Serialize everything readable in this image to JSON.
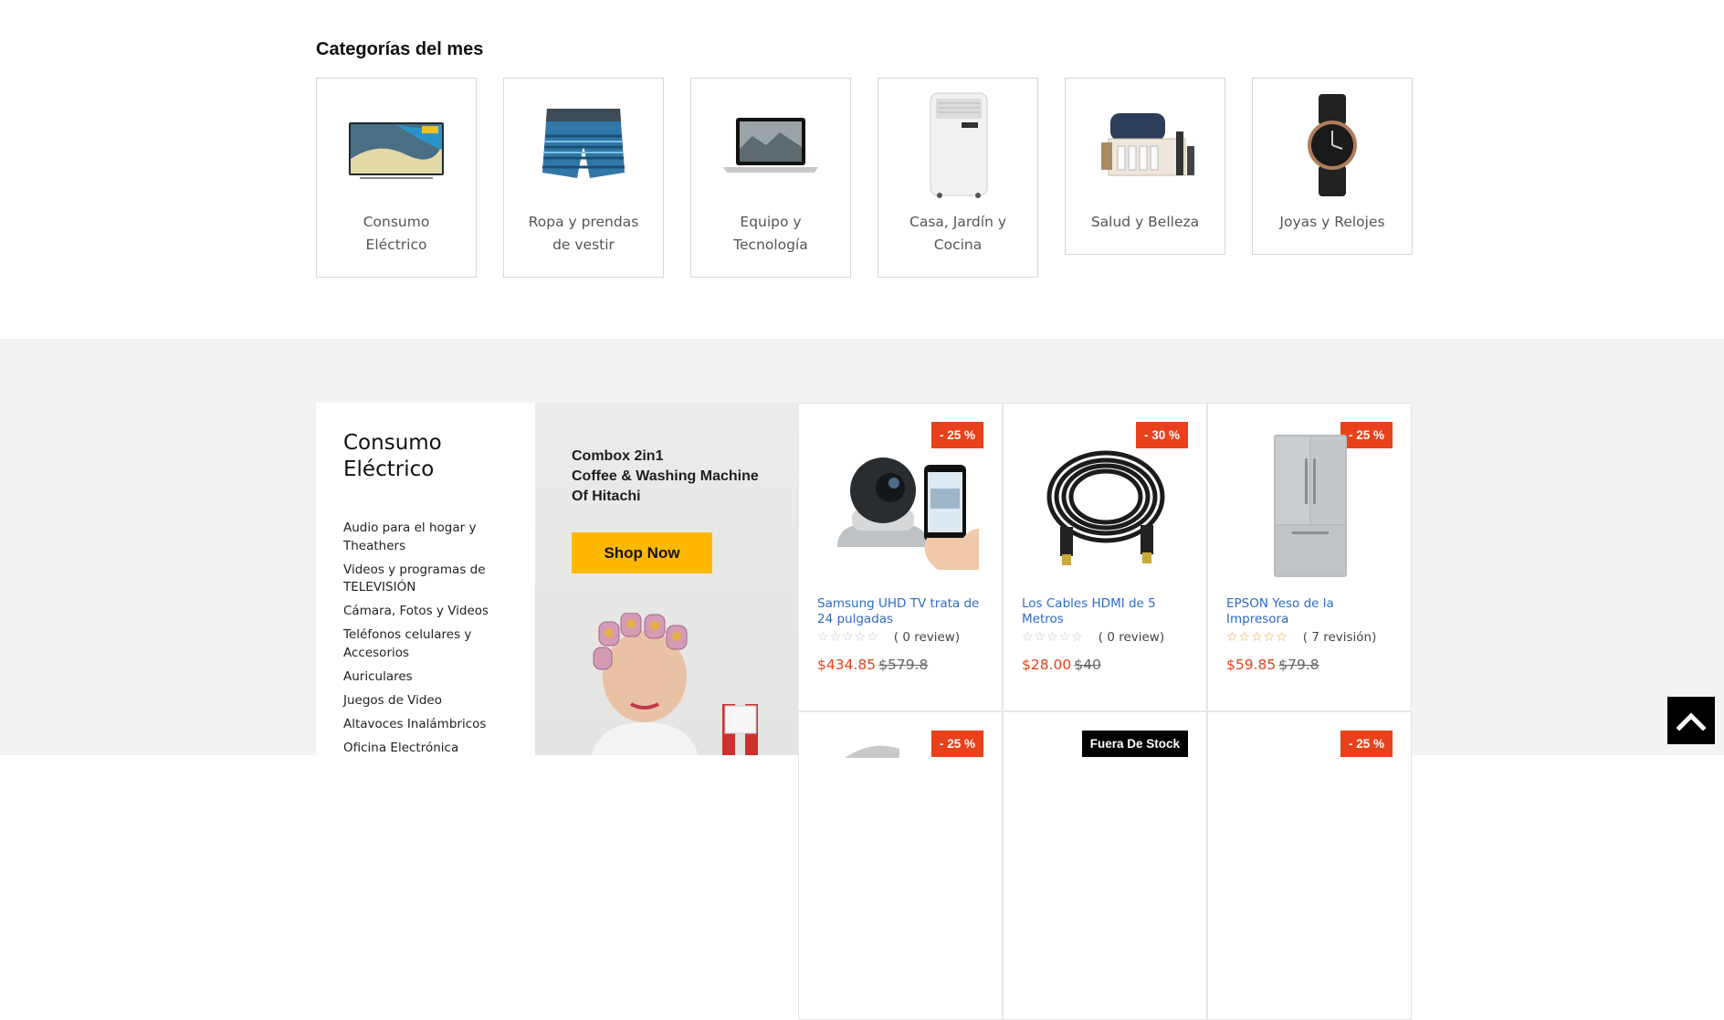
{
  "categories": {
    "title": "Categorías del mes",
    "items": [
      {
        "label_line1": "Consumo",
        "label_line2": "Eléctrico",
        "icon": "tv-image"
      },
      {
        "label_line1": "Ropa y prendas",
        "label_line2": "de vestir",
        "icon": "swim-shorts-image"
      },
      {
        "label_line1": "Equipo y",
        "label_line2": "Tecnología",
        "icon": "laptop-image"
      },
      {
        "label_line1": "Casa, Jardín y",
        "label_line2": "Cocina",
        "icon": "air-conditioner-image"
      },
      {
        "label_line1": "Salud y Belleza",
        "label_line2": "",
        "icon": "beauty-kit-image"
      },
      {
        "label_line1": "Joyas y Relojes",
        "label_line2": "",
        "icon": "watch-image"
      }
    ]
  },
  "sidebar": {
    "title_line1": "Consumo",
    "title_line2": "Eléctrico",
    "items": [
      "Audio para el hogar y Theathers",
      "Videos y programas de TELEVISIÓN",
      "Cámara, Fotos y Videos",
      "Teléfonos celulares y Accesorios",
      "Auriculares",
      "Juegos de Video",
      "Altavoces Inalámbricos",
      "Oficina Electrónica"
    ]
  },
  "banner": {
    "line1": "Combox 2in1",
    "line2": "Coffee & Washing Machine",
    "line3": "Of Hitachi",
    "button": "Shop Now"
  },
  "products": [
    {
      "badge": "- 25 %",
      "name": "Samsung UHD TV trata de 24 pulgadas",
      "stars": 0,
      "reviews": "( 0 review)",
      "price": "$434.85",
      "old_price": "$579.8",
      "icon": "ip-camera-image"
    },
    {
      "badge": "- 30 %",
      "name": "Los Cables HDMI de 5 Metros",
      "stars": 0,
      "reviews": "( 0 review)",
      "price": "$28.00",
      "old_price": "$40",
      "icon": "hdmi-cable-image"
    },
    {
      "badge": "- 25 %",
      "name": "EPSON Yeso de la Impresora",
      "stars": 0,
      "reviews": "( 7 revisión)",
      "price": "$59.85",
      "old_price": "$79.8",
      "icon": "fridge-image"
    },
    {
      "badge": "- 25 %"
    },
    {
      "badge": "Fuera De Stock"
    },
    {
      "badge": "- 25 %"
    }
  ],
  "colors": {
    "accent": "#e8411b",
    "link": "#2e6bc6",
    "button": "#ffb700",
    "section_bg": "#f2f3f2"
  },
  "scroll_top_icon": "chevron-up-icon"
}
